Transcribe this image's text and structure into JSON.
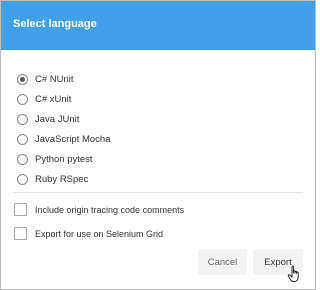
{
  "dialog": {
    "title": "Select language"
  },
  "languages": [
    {
      "label": "C# NUnit",
      "selected": true
    },
    {
      "label": "C# xUnit",
      "selected": false
    },
    {
      "label": "Java JUnit",
      "selected": false
    },
    {
      "label": "JavaScript Mocha",
      "selected": false
    },
    {
      "label": "Python pytest",
      "selected": false
    },
    {
      "label": "Ruby RSpec",
      "selected": false
    }
  ],
  "options": {
    "origin_tracing": {
      "label": "Include origin tracing code comments",
      "checked": false
    },
    "selenium_grid": {
      "label": "Export for use on Selenium Grid",
      "checked": false
    }
  },
  "buttons": {
    "cancel": "Cancel",
    "export": "Export"
  },
  "colors": {
    "header": "#42a0e8",
    "header_text": "#ffffff"
  },
  "icons": {
    "cursor": "hand-pointer-icon"
  }
}
